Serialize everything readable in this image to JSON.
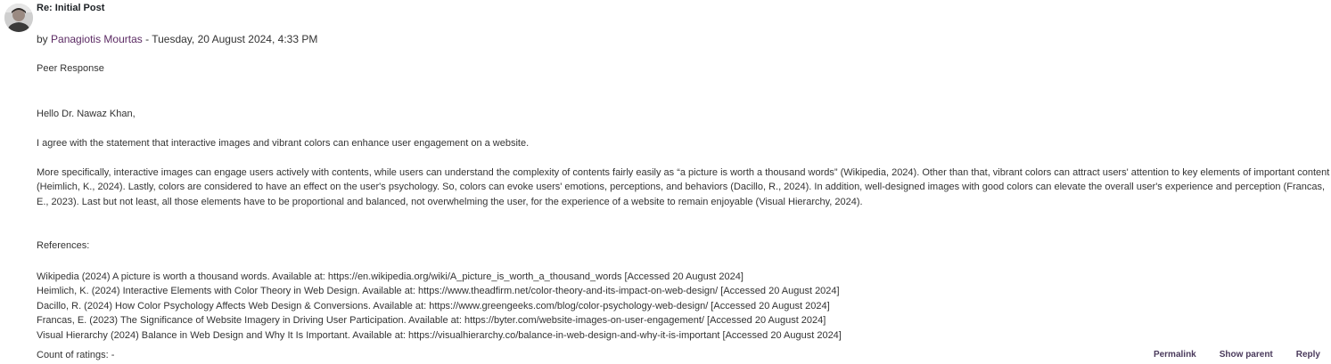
{
  "post": {
    "subject": "Re: Initial Post",
    "by_prefix": "by",
    "author": "Panagiotis Mourtas",
    "date_sep": " - ",
    "date": "Tuesday, 20 August 2024, 4:33 PM",
    "heading": "Peer Response",
    "greeting": "Hello Dr. Nawaz Khan,",
    "para1": "I agree with the statement that interactive images and vibrant colors can enhance user engagement on a website.",
    "para2": "More specifically, interactive images can engage users actively with contents, while users can understand the complexity of contents fairly easily as “a picture is worth a thousand words” (Wikipedia, 2024). Other than that, vibrant colors can attract users' attention to key elements of important content (Heimlich, K., 2024). Lastly, colors are considered to have an effect on the user's psychology. So, colors can evoke users' emotions, perceptions, and behaviors (Dacillo, R., 2024). In addition, well-designed images with good colors can elevate the overall user's experience and perception (Francas, E., 2023). Last but not least, all those elements have to be proportional and balanced, not overwhelming the user, for the experience of a website to remain enjoyable (Visual Hierarchy, 2024).",
    "references_title": "References:",
    "references": [
      "Wikipedia (2024) A picture is worth a thousand words. Available at: https://en.wikipedia.org/wiki/A_picture_is_worth_a_thousand_words [Accessed 20 August 2024]",
      "Heimlich, K. (2024) Interactive Elements with Color Theory in Web Design. Available at: https://www.theadfirm.net/color-theory-and-its-impact-on-web-design/ [Accessed 20 August 2024]",
      "Dacillo, R. (2024) How Color Psychology Affects Web Design & Conversions. Available at: https://www.greengeeks.com/blog/color-psychology-web-design/ [Accessed 20 August 2024]",
      "Francas, E. (2023) The Significance of Website Imagery in Driving User Participation. Available at: https://byter.com/website-images-on-user-engagement/ [Accessed 20 August 2024]",
      "Visual Hierarchy (2024) Balance in Web Design and Why It Is Important. Available at: https://visualhierarchy.co/balance-in-web-design-and-why-it-is-important [Accessed 20 August 2024]"
    ],
    "ratings": "Count of ratings: -"
  },
  "commands": {
    "permalink": "Permalink",
    "show_parent": "Show parent",
    "reply": "Reply"
  },
  "colors": {
    "author_link": "#5b2a63",
    "command_link": "#4a3a5c",
    "text": "#333333"
  }
}
